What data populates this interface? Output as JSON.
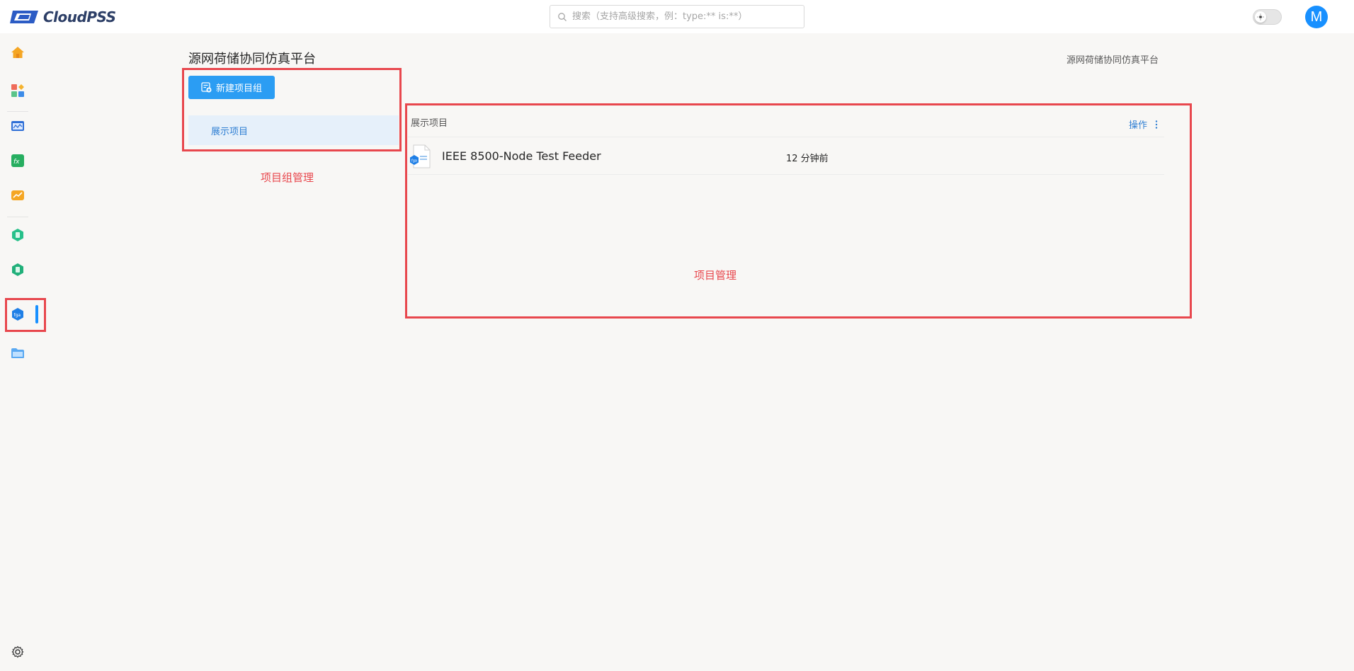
{
  "header": {
    "logo_text": "CloudPSS",
    "search_placeholder": "搜索（支持高级搜索，例：type:** is:**）",
    "avatar_letter": "M"
  },
  "sidebar": {
    "items": [
      {
        "name": "home",
        "icon": "home-icon"
      },
      {
        "name": "apps",
        "icon": "apps-icon"
      },
      {
        "name": "simstudio",
        "icon": "chart-window-icon"
      },
      {
        "name": "function",
        "icon": "fx-icon"
      },
      {
        "name": "analysis",
        "icon": "trend-icon"
      },
      {
        "name": "module-a",
        "icon": "hexagon-doc-icon"
      },
      {
        "name": "module-b",
        "icon": "hexagon-doc-icon"
      },
      {
        "name": "project-platform",
        "icon": "hexagon-project-icon",
        "active": true
      },
      {
        "name": "files",
        "icon": "folder-icon"
      }
    ],
    "settings_icon": "gear-icon"
  },
  "main": {
    "title": "源网荷储协同仿真平台",
    "breadcrumb": "源网荷储协同仿真平台",
    "new_group_button": "新建项目组",
    "groups": [
      {
        "label": "展示项目",
        "selected": true
      }
    ],
    "annotation_groups": "项目组管理",
    "panel": {
      "title": "展示项目",
      "actions_label": "操作",
      "projects": [
        {
          "name": "IEEE 8500-Node Test Feeder",
          "time": "12 分钟前"
        }
      ],
      "annotation": "项目管理"
    }
  },
  "colors": {
    "accent": "#2b9df3",
    "link": "#2f7fd3",
    "annotation_red": "#e8474d",
    "selected_bg": "#e6f0fa",
    "page_bg": "#f8f7f5"
  }
}
